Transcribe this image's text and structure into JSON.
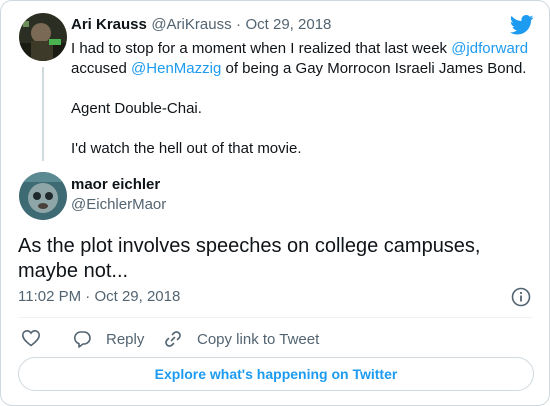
{
  "parent_tweet": {
    "author_name": "Ari Krauss",
    "author_handle": "@AriKrauss",
    "separator": "·",
    "date": "Oct 29, 2018",
    "line1_pre": "I had to stop for a moment when I realized that last week ",
    "mention1": "@jdforward",
    "line2_pre": "accused ",
    "mention2": "@HenMazzig",
    "line2_post": " of being a Gay Morrocon Israeli James Bond.",
    "para2": "Agent Double-Chai.",
    "para3": "I'd watch the hell out of that movie."
  },
  "main_tweet": {
    "author_name": "maor eichler",
    "author_handle": "@EichlerMaor",
    "text_line1": "As the plot involves speeches on college campuses,",
    "text_line2": "maybe not...",
    "time": "11:02 PM",
    "separator": "·",
    "date": "Oct 29, 2018"
  },
  "actions": {
    "reply_label": "Reply",
    "copy_link_label": "Copy link to Tweet"
  },
  "explore_button_label": "Explore what's happening on Twitter",
  "colors": {
    "accent": "#1d9bf0",
    "text": "#0f1419",
    "muted": "#536471",
    "border": "#cfd9de"
  },
  "icons": [
    "twitter-bird-icon",
    "info-icon",
    "heart-icon",
    "reply-icon",
    "link-icon"
  ]
}
